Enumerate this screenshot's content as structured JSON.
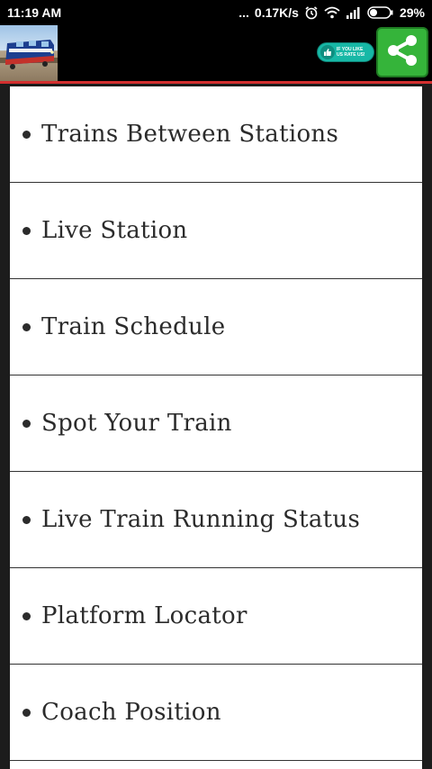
{
  "status_bar": {
    "time": "11:19 AM",
    "dots": "...",
    "speed": "0.17K/s",
    "battery": "29%",
    "icons": [
      "alarm-icon",
      "wifi-icon",
      "signal-icon",
      "battery-icon"
    ]
  },
  "header": {
    "logo_icon": "train-logo",
    "like_badge_text": "IF YOU LIKE\nUS RATE US!",
    "share_icon": "share-icon",
    "accent_color": "#d32f2f",
    "share_color": "#35b43a"
  },
  "menu": {
    "items": [
      {
        "label": "Trains Between Stations"
      },
      {
        "label": "Live Station"
      },
      {
        "label": "Train Schedule"
      },
      {
        "label": "Spot Your Train"
      },
      {
        "label": "Live Train Running Status"
      },
      {
        "label": "Platform Locator"
      },
      {
        "label": "Coach Position"
      }
    ]
  }
}
